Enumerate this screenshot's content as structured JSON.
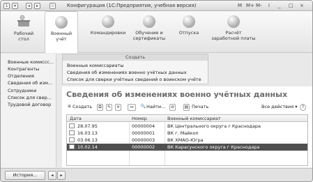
{
  "titlebar": {
    "title": "Конфигурация  (1С:Предприятие, учебная версия)",
    "buttons": [
      "◂",
      "▸",
      "☆"
    ],
    "right": {
      "m": "M",
      "mplus": "M+",
      "mminus": "M-",
      "info": "i",
      "min": "_",
      "max": "□",
      "close": "×"
    }
  },
  "sections": [
    {
      "label": "Рабочий\nстол",
      "icon": "desktop-icon"
    },
    {
      "label": "Военный\nучёт",
      "icon": "section-icon"
    },
    {
      "label": "Командировки",
      "icon": "section-icon"
    },
    {
      "label": "Обучение и\nсертификаты",
      "icon": "section-icon"
    },
    {
      "label": "Отпуска",
      "icon": "section-icon"
    },
    {
      "label": "Расчёт\nзаработной платы",
      "icon": "section-icon"
    }
  ],
  "leftnav": {
    "items": [
      "Военные комиссс...",
      "Контрагенты",
      "Отделения",
      "Сведения об изм...",
      "Сотрудники",
      "Список для свер...",
      "Трудовой договор"
    ]
  },
  "create_panel": {
    "header": "Создать",
    "items": [
      "Военные комиссариаты",
      "Сведения об изменениях военно учётных данных",
      "Список для сверки учётных сведений о воинском учёте"
    ]
  },
  "main": {
    "title": "Сведения об изменениях военно учётных данных",
    "toolbar": {
      "create": "Создать",
      "find": "Найти...",
      "print": "Печать",
      "all_actions": "Все действия ▾",
      "help": "?"
    },
    "columns": [
      "Дата",
      "Номер",
      "Военный комиссариат"
    ],
    "rows": [
      [
        "28.07.95",
        "00000004",
        "ВК Центрального округа г Краснодара"
      ],
      [
        "16.03.13",
        "00000001",
        "ВК г. Майкоп"
      ],
      [
        "03.06.13",
        "00000003",
        "ВК ХМАО-Югра"
      ],
      [
        "10.02.14",
        "00000002",
        "ВК Карасунского округа г Краснодара"
      ]
    ],
    "selected_row": 3
  },
  "bottom": {
    "history": "История...",
    "prev": "◂",
    "next": "▸"
  }
}
